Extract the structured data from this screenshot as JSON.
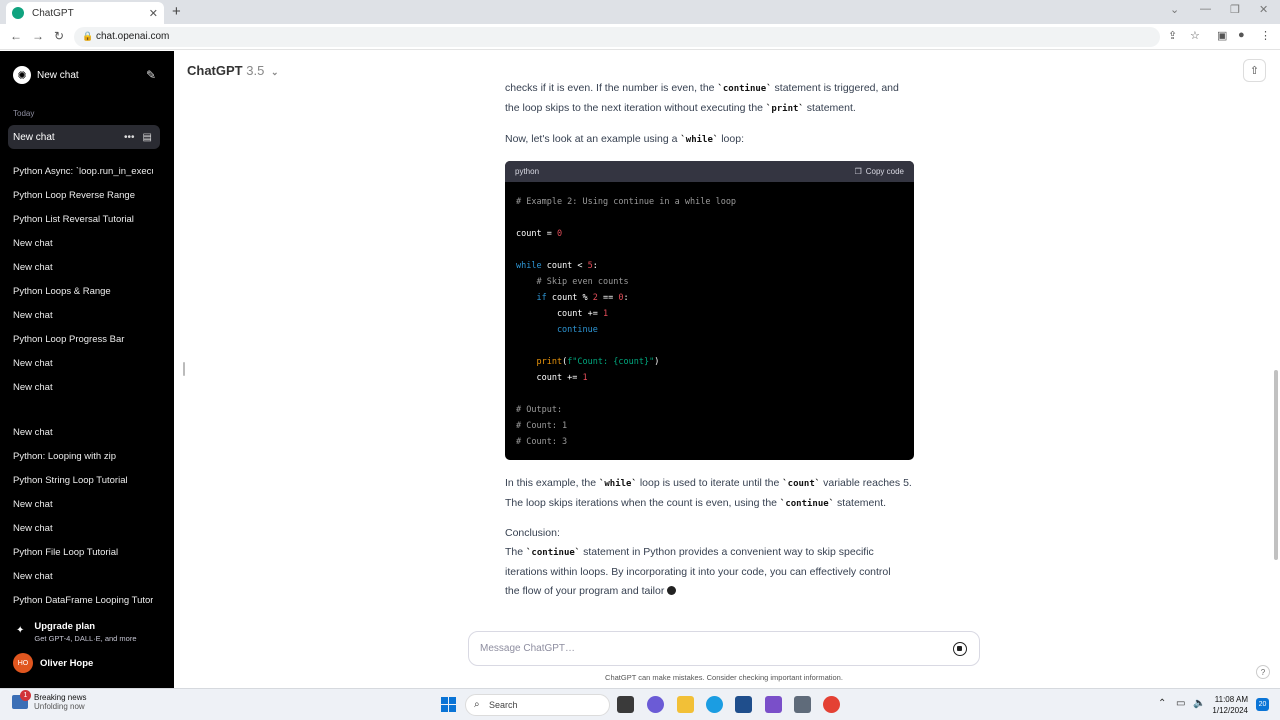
{
  "browser": {
    "tab_title": "ChatGPT",
    "tab_close": "✕",
    "new_tab": "+",
    "url": "chat.openai.com",
    "win_min": "—",
    "win_max": "❐",
    "win_close": "✕"
  },
  "sidebar": {
    "new_chat": "New chat",
    "today": "Today",
    "active_chat": "New chat",
    "items": [
      "Python Async: `loop.run_in_executor`",
      "Python Loop Reverse Range",
      "Python List Reversal Tutorial",
      "New chat",
      "New chat",
      "Python Loops & Range",
      "New chat",
      "Python Loop Progress Bar",
      "New chat",
      "New chat",
      "New chat",
      "Python: Looping with zip",
      "Python String Loop Tutorial",
      "New chat",
      "New chat",
      "Python File Loop Tutorial",
      "New chat",
      "Python DataFrame Looping Tutorial"
    ],
    "upgrade_title": "Upgrade plan",
    "upgrade_sub": "Get GPT-4, DALL·E, and more",
    "user_initials": "HO",
    "user_name": "Oliver Hope"
  },
  "header": {
    "model": "ChatGPT",
    "version": "3.5"
  },
  "message": {
    "p0_a": "checks if it is even. If the number is even, the ",
    "p0_code": "`continue`",
    "p0_b": " statement is triggered, and",
    "p0_c": "the loop skips to the next iteration without executing the ",
    "p0_code2": "`print`",
    "p0_d": " statement.",
    "p1_a": "Now, let's look at an example using a ",
    "p1_code": "`while`",
    "p1_b": " loop:",
    "code_lang": "python",
    "copy_label": "Copy code",
    "p2_a": "In this example, the ",
    "p2_code": "`while`",
    "p2_b": " loop is used to iterate until the ",
    "p2_code2": "`count`",
    "p2_c": " variable reaches 5.",
    "p2_d": "The loop skips iterations when the count is even, using the ",
    "p2_code3": "`continue`",
    "p2_e": " statement.",
    "p3": "Conclusion:",
    "p4_a": "The ",
    "p4_code": "`continue`",
    "p4_b": " statement in Python provides a convenient way to skip specific",
    "p4_c": "iterations within loops. By incorporating it into your code, you can effectively control",
    "p4_d": "the flow of your program and tailor"
  },
  "code": {
    "l1": "# Example 2: Using continue in a while loop",
    "l3a": "count = ",
    "l3b": "0",
    "l5a": "while",
    "l5b": " count < ",
    "l5c": "5",
    "l5d": ":",
    "l6": "    # Skip even counts",
    "l7a": "    if",
    "l7b": " count % ",
    "l7c": "2",
    "l7d": " == ",
    "l7e": "0",
    "l7f": ":",
    "l8a": "        count += ",
    "l8b": "1",
    "l9": "        continue",
    "l11a": "    print",
    "l11b": "(",
    "l11c": "f\"Count: {count}\"",
    "l11d": ")",
    "l12a": "    count += ",
    "l12b": "1",
    "l14": "# Output:",
    "l15": "# Count: 1",
    "l16": "# Count: 3"
  },
  "composer": {
    "placeholder": "Message ChatGPT…",
    "disclaimer": "ChatGPT can make mistakes. Consider checking important information."
  },
  "taskbar": {
    "news_badge": "1",
    "news_title": "Breaking news",
    "news_sub": "Unfolding now",
    "search": "Search",
    "time": "11:08 AM",
    "date": "1/12/2024",
    "notif": "20"
  }
}
